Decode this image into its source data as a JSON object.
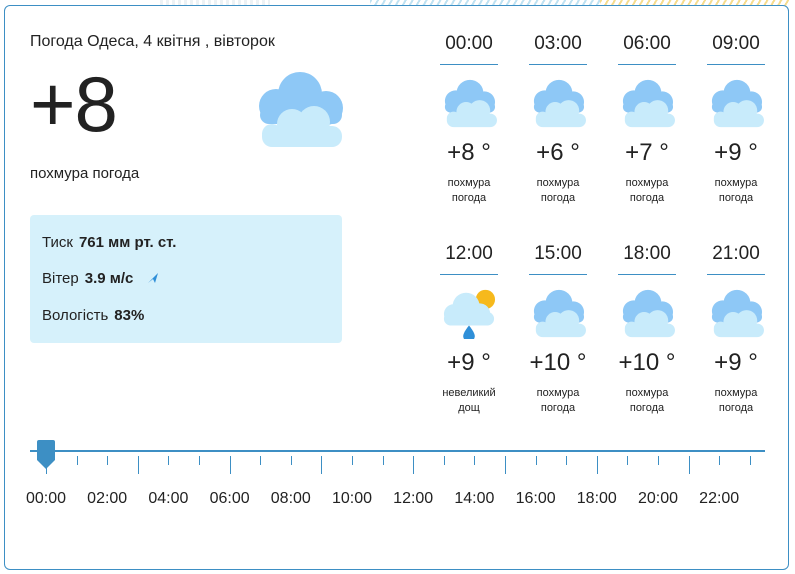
{
  "title": "Погода Одеса, 4 квітня , вівторок",
  "current": {
    "temperature": "+8",
    "condition": "похмура погода",
    "icon": "cloudy-icon"
  },
  "details": {
    "pressure_label": "Тиск",
    "pressure_value": "761 мм рт. ст.",
    "wind_label": "Вітер",
    "wind_value": "3.9 м/с",
    "humidity_label": "Вологість",
    "humidity_value": "83%"
  },
  "hourly": [
    {
      "time": "00:00",
      "temp": "+8 °",
      "desc": [
        "похмура",
        "погода"
      ],
      "icon": "cloudy-icon"
    },
    {
      "time": "03:00",
      "temp": "+6 °",
      "desc": [
        "похмура",
        "погода"
      ],
      "icon": "cloudy-icon"
    },
    {
      "time": "06:00",
      "temp": "+7 °",
      "desc": [
        "похмура",
        "погода"
      ],
      "icon": "cloudy-icon"
    },
    {
      "time": "09:00",
      "temp": "+9 °",
      "desc": [
        "похмура",
        "погода"
      ],
      "icon": "cloudy-icon"
    },
    {
      "time": "12:00",
      "temp": "+9 °",
      "desc": [
        "невеликий",
        "дощ"
      ],
      "icon": "sun-rain-cloud-icon"
    },
    {
      "time": "15:00",
      "temp": "+10 °",
      "desc": [
        "похмура",
        "погода"
      ],
      "icon": "cloudy-icon"
    },
    {
      "time": "18:00",
      "temp": "+10 °",
      "desc": [
        "похмура",
        "погода"
      ],
      "icon": "cloudy-icon"
    },
    {
      "time": "21:00",
      "temp": "+9 °",
      "desc": [
        "похмура",
        "погода"
      ],
      "icon": "cloudy-icon"
    }
  ],
  "timeline": {
    "labels": [
      "00:00",
      "02:00",
      "04:00",
      "06:00",
      "08:00",
      "10:00",
      "12:00",
      "14:00",
      "16:00",
      "18:00",
      "20:00",
      "22:00"
    ],
    "selected": "00:00"
  },
  "colors": {
    "accent": "#3d8fc4",
    "details_bg": "#d6f1fb",
    "cloud_back": "#8ec8f6",
    "cloud_front": "#c8ebfb",
    "sun": "#f6b91c",
    "rain": "#2f8fd8"
  }
}
